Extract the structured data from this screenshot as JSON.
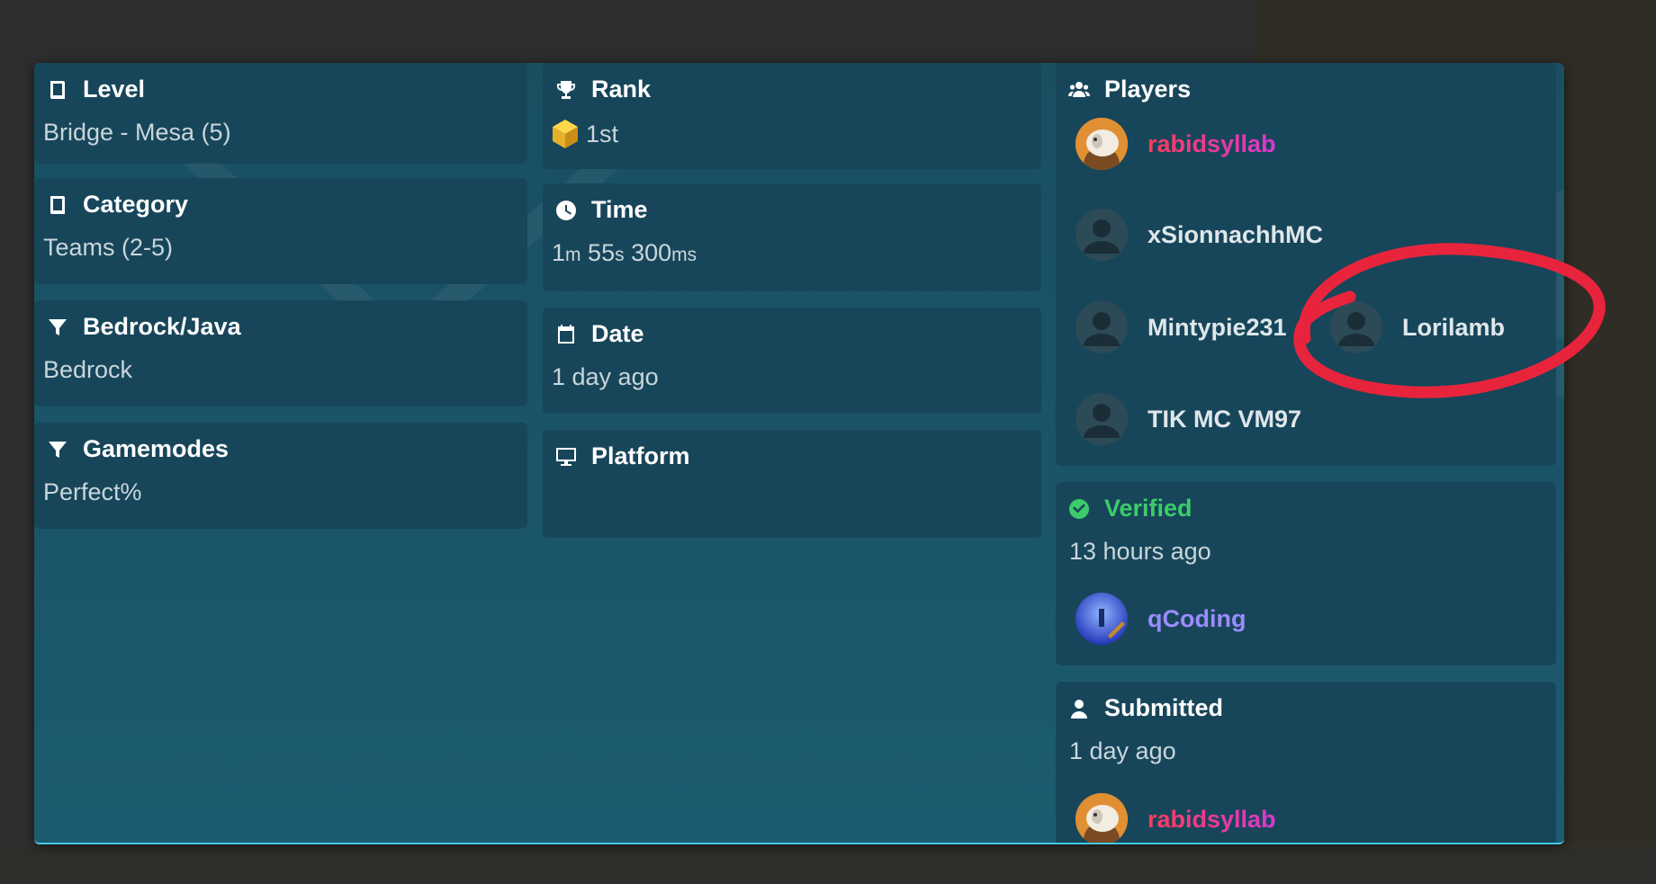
{
  "level": {
    "label": "Level",
    "value": "Bridge - Mesa (5)"
  },
  "category": {
    "label": "Category",
    "value": "Teams (2-5)"
  },
  "edition": {
    "label": "Bedrock/Java",
    "value": "Bedrock"
  },
  "gamemodes": {
    "label": "Gamemodes",
    "value": "Perfect%"
  },
  "rank": {
    "label": "Rank",
    "value": "1st"
  },
  "time": {
    "label": "Time",
    "minutes": "1",
    "minutes_unit": "m",
    "seconds": "55",
    "seconds_unit": "s",
    "millis": "300",
    "millis_unit": "ms"
  },
  "date": {
    "label": "Date",
    "value": "1 day ago"
  },
  "platform": {
    "label": "Platform",
    "value": ""
  },
  "players": {
    "label": "Players",
    "list": [
      {
        "name": "rabidsyllab"
      },
      {
        "name": "xSionnachhMC"
      },
      {
        "name": "Mintypie231"
      },
      {
        "name": "Lorilamb"
      },
      {
        "name": "TIK MC VM97"
      }
    ]
  },
  "verified": {
    "label": "Verified",
    "value": "13 hours ago",
    "by": "qCoding"
  },
  "submitted": {
    "label": "Submitted",
    "value": "1 day ago",
    "by": "rabidsyllab"
  },
  "colors": {
    "verified_green": "#3ccb6a",
    "annotation_red": "#e8243c",
    "accent_cyan": "#45c8e6"
  }
}
